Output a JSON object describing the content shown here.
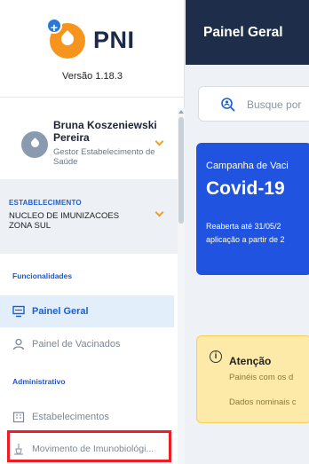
{
  "app": {
    "logo_text": "PNI",
    "version": "Versão 1.18.3"
  },
  "user": {
    "name": "Bruna Koszeniewski Pereira",
    "role": "Gestor Estabelecimento de Saúde"
  },
  "establishment": {
    "label": "ESTABELECIMENTO",
    "name": "NUCLEO DE IMUNIZACOES ZONA SUL"
  },
  "nav": {
    "section_functionalities": "Funcionalidades",
    "painel_geral": "Painel Geral",
    "painel_vacinados": "Painel de Vacinados",
    "section_admin": "Administrativo",
    "estabelecimentos": "Estabelecimentos",
    "movimento": "Movimento de Imunobiológi..."
  },
  "header": {
    "title": "Painel Geral"
  },
  "search": {
    "placeholder": "Busque por"
  },
  "campaign": {
    "subtitle": "Campanha de Vaci",
    "title": "Covid-19",
    "line1": "Reaberta até 31/05/2",
    "line2": "aplicação a partir de 2"
  },
  "alert": {
    "title": "Atenção",
    "line1": "Painéis com os d",
    "line2": "Dados nominais c"
  },
  "colors": {
    "header_bg": "#1e2e4a",
    "brand_orange": "#f7941d",
    "brand_blue": "#1f53e0",
    "alert_bg": "#fde9a8",
    "highlight": "#ee1c24"
  }
}
